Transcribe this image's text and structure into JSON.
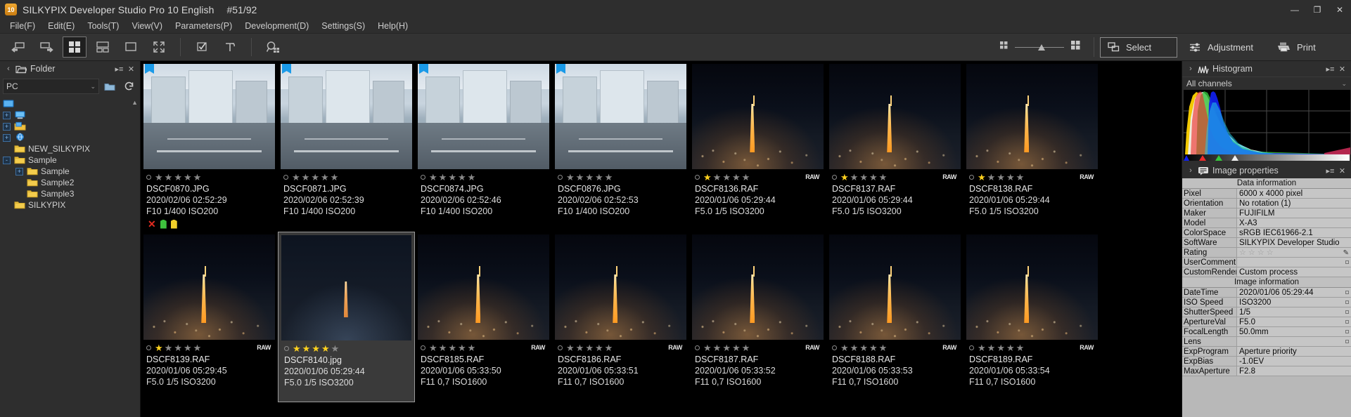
{
  "titlebar": {
    "app_icon_text": "10",
    "title": "SILKYPIX Developer Studio Pro 10 English",
    "counter": "#51/92",
    "minimize": "—",
    "maximize": "❐",
    "close": "✕"
  },
  "menubar": {
    "items": [
      {
        "label": "File(F)"
      },
      {
        "label": "Edit(E)"
      },
      {
        "label": "Tools(T)"
      },
      {
        "label": "View(V)"
      },
      {
        "label": "Parameters(P)"
      },
      {
        "label": "Development(D)"
      },
      {
        "label": "Settings(S)"
      },
      {
        "label": "Help(H)"
      }
    ]
  },
  "toolbar": {
    "buttons": [
      {
        "name": "back-icon"
      },
      {
        "name": "forward-icon"
      },
      {
        "name": "grid-view-icon"
      },
      {
        "name": "filmstrip-view-icon"
      },
      {
        "name": "single-view-icon"
      },
      {
        "name": "fullscreen-icon"
      },
      {
        "name": "checkbox-select-icon"
      },
      {
        "name": "tools-hammer-icon"
      },
      {
        "name": "search-thumbnails-icon"
      }
    ],
    "zoom_slider": {
      "small_icon": "small-grid-icon",
      "large_icon": "large-grid-icon"
    },
    "modes": [
      {
        "label": "Select",
        "icon": "select-icon",
        "selected": true
      },
      {
        "label": "Adjustment",
        "icon": "sliders-icon",
        "selected": false
      },
      {
        "label": "Print",
        "icon": "printer-icon",
        "selected": false
      }
    ]
  },
  "left_panel": {
    "header": {
      "title": "Folder",
      "icon": "folder-open-icon",
      "collapse": "‹",
      "menu": "▸≡",
      "close": "✕"
    },
    "combo": {
      "value": "PC",
      "arrow": "⌄"
    },
    "buttons": [
      {
        "name": "new-folder-icon"
      },
      {
        "name": "refresh-icon"
      }
    ],
    "tree": [
      {
        "label": "",
        "icon": "desktop-root-icon",
        "indent": 0,
        "expander": "none"
      },
      {
        "label": "",
        "icon": "computer-icon",
        "indent": 1,
        "expander": "+"
      },
      {
        "label": "",
        "icon": "libraries-icon",
        "indent": 1,
        "expander": "+"
      },
      {
        "label": "",
        "icon": "network-icon",
        "indent": 1,
        "expander": "+"
      },
      {
        "label": "NEW_SILKYPIX",
        "icon": "folder-icon",
        "indent": 1,
        "expander": "none"
      },
      {
        "label": "Sample",
        "icon": "folder-icon",
        "indent": 1,
        "expander": "-"
      },
      {
        "label": "Sample",
        "icon": "folder-icon",
        "indent": 2,
        "expander": "+"
      },
      {
        "label": "Sample2",
        "icon": "folder-icon",
        "indent": 2,
        "expander": "none"
      },
      {
        "label": "Sample3",
        "icon": "folder-icon",
        "indent": 2,
        "expander": "none"
      },
      {
        "label": "SILKYPIX",
        "icon": "folder-icon",
        "indent": 1,
        "expander": "none"
      }
    ]
  },
  "thumbnails": [
    {
      "filename": "DSCF0870.JPG",
      "date": "2020/02/06 02:52:29",
      "exif": "F10 1/400 ISO200",
      "rating": 0,
      "raw": false,
      "flag": true,
      "selected": false,
      "art": "city",
      "labels": [
        "x",
        "green",
        "yellow"
      ]
    },
    {
      "filename": "DSCF0871.JPG",
      "date": "2020/02/06 02:52:39",
      "exif": "F10 1/400 ISO200",
      "rating": 0,
      "raw": false,
      "flag": true,
      "selected": false,
      "art": "city",
      "labels": []
    },
    {
      "filename": "DSCF0874.JPG",
      "date": "2020/02/06 02:52:46",
      "exif": "F10 1/400 ISO200",
      "rating": 0,
      "raw": false,
      "flag": true,
      "selected": false,
      "art": "city",
      "labels": []
    },
    {
      "filename": "DSCF0876.JPG",
      "date": "2020/02/06 02:52:53",
      "exif": "F10 1/400 ISO200",
      "rating": 0,
      "raw": false,
      "flag": true,
      "selected": false,
      "art": "city",
      "labels": []
    },
    {
      "filename": "DSCF8136.RAF",
      "date": "2020/01/06 05:29:44",
      "exif": "F5.0 1/5 ISO3200",
      "rating": 1,
      "raw": true,
      "flag": false,
      "selected": false,
      "art": "night",
      "labels": []
    },
    {
      "filename": "DSCF8137.RAF",
      "date": "2020/01/06 05:29:44",
      "exif": "F5.0 1/5 ISO3200",
      "rating": 1,
      "raw": true,
      "flag": false,
      "selected": false,
      "art": "night",
      "labels": []
    },
    {
      "filename": "DSCF8138.RAF",
      "date": "2020/01/06 05:29:44",
      "exif": "F5.0 1/5 ISO3200",
      "rating": 1,
      "raw": true,
      "flag": false,
      "selected": false,
      "art": "night",
      "labels": []
    },
    {
      "filename": "DSCF8139.RAF",
      "date": "2020/01/06 05:29:45",
      "exif": "F5.0 1/5 ISO3200",
      "rating": 1,
      "raw": true,
      "flag": false,
      "selected": false,
      "art": "night",
      "labels": []
    },
    {
      "filename": "DSCF8140.jpg",
      "date": "2020/01/06 05:29:44",
      "exif": "F5.0 1/5 ISO3200",
      "rating": 4,
      "raw": false,
      "flag": false,
      "selected": true,
      "art": "night2",
      "labels": []
    },
    {
      "filename": "DSCF8185.RAF",
      "date": "2020/01/06 05:33:50",
      "exif": "F11 0,7 ISO1600",
      "rating": 0,
      "raw": true,
      "flag": false,
      "selected": false,
      "art": "night",
      "labels": []
    },
    {
      "filename": "DSCF8186.RAF",
      "date": "2020/01/06 05:33:51",
      "exif": "F11 0,7 ISO1600",
      "rating": 0,
      "raw": true,
      "flag": false,
      "selected": false,
      "art": "night",
      "labels": []
    },
    {
      "filename": "DSCF8187.RAF",
      "date": "2020/01/06 05:33:52",
      "exif": "F11 0,7 ISO1600",
      "rating": 0,
      "raw": true,
      "flag": false,
      "selected": false,
      "art": "night",
      "labels": []
    },
    {
      "filename": "DSCF8188.RAF",
      "date": "2020/01/06 05:33:53",
      "exif": "F11 0,7 ISO1600",
      "rating": 0,
      "raw": true,
      "flag": false,
      "selected": false,
      "art": "night",
      "labels": []
    },
    {
      "filename": "DSCF8189.RAF",
      "date": "2020/01/06 05:33:54",
      "exif": "F11 0,7 ISO1600",
      "rating": 0,
      "raw": true,
      "flag": false,
      "selected": false,
      "art": "night",
      "labels": []
    }
  ],
  "right_panel": {
    "histogram": {
      "header": {
        "title": "Histogram",
        "icon": "histogram-icon",
        "expand": "›",
        "menu": "▸≡",
        "close": "✕"
      },
      "channel_select": "All channels",
      "channel_arrow": "⌄"
    },
    "image_properties": {
      "header": {
        "title": "Image properties",
        "icon": "properties-icon",
        "expand": "›",
        "menu": "▸≡",
        "close": "✕"
      },
      "sections": [
        {
          "title": "Data information",
          "rows": [
            {
              "key": "Pixel",
              "value": "6000 x 4000 pixel"
            },
            {
              "key": "Orientation",
              "value": "No rotation (1)"
            },
            {
              "key": "Maker",
              "value": "FUJIFILM"
            },
            {
              "key": "Model",
              "value": "X-A3"
            },
            {
              "key": "ColorSpace",
              "value": "sRGB IEC61966-2.1"
            },
            {
              "key": "SoftWare",
              "value": "SILKYPIX Developer Studio"
            },
            {
              "key": "Rating",
              "value": "☆ ☆ ☆ ☆",
              "pencil": true
            },
            {
              "key": "UserComment",
              "value": "",
              "mini": true
            },
            {
              "key": "CustomRender",
              "value": "Custom process"
            }
          ]
        },
        {
          "title": "Image information",
          "rows": [
            {
              "key": "DateTime",
              "value": "2020/01/06 05:29:44",
              "mini": true
            },
            {
              "key": "ISO Speed",
              "value": "ISO3200",
              "mini": true
            },
            {
              "key": "ShutterSpeed",
              "value": "1/5",
              "mini": true
            },
            {
              "key": "ApertureVal",
              "value": "F5.0",
              "mini": true
            },
            {
              "key": "FocalLength",
              "value": "50.0mm",
              "mini": true
            },
            {
              "key": "Lens",
              "value": "",
              "mini": true
            },
            {
              "key": "ExpProgram",
              "value": "Aperture priority"
            },
            {
              "key": "ExpBias",
              "value": "-1.0EV"
            },
            {
              "key": "MaxAperture",
              "value": "F2.8"
            }
          ]
        }
      ]
    }
  },
  "colors": {
    "accent_blue": "#1a9ae8",
    "star_gold": "#ffd21e",
    "label_red": "#e02b20",
    "label_green": "#3ec23e",
    "label_yellow": "#f2d02a",
    "panel_bg": "#2e2e2e",
    "canvas_bg": "#000000"
  }
}
